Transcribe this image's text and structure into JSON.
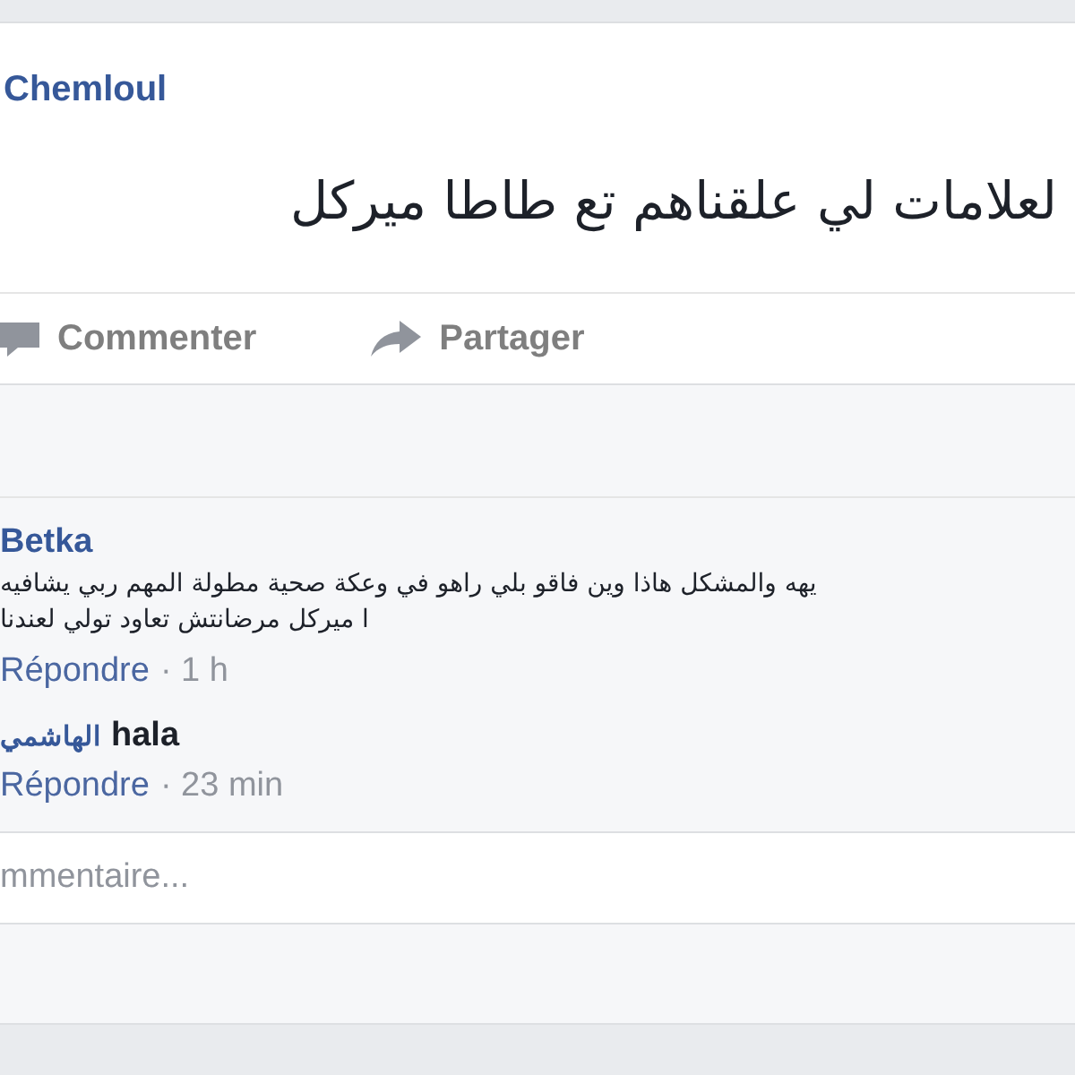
{
  "post": {
    "author": "Chemloul",
    "text": "لعلامات لي علقناهم تع طاطا ميركل"
  },
  "actions": [
    {
      "kind": "comment",
      "label": "Commenter"
    },
    {
      "kind": "share",
      "label": "Partager"
    }
  ],
  "comments": [
    {
      "author": "Betka",
      "lines": [
        "يهه والمشكل هاذا وين فاقو بلي راهو في وعكة صحية مطولة المهم ربي يشافيه",
        "ا ميركل مرضانتش تعاود تولي لعندنا"
      ],
      "reply": "Répondre",
      "time": "· 1 h"
    },
    {
      "author": "الهاشمي",
      "lines": [
        "hala"
      ],
      "reply": "Répondre",
      "time": "· 23 min"
    }
  ],
  "comment_box": {
    "placeholder": "mmentaire..."
  }
}
